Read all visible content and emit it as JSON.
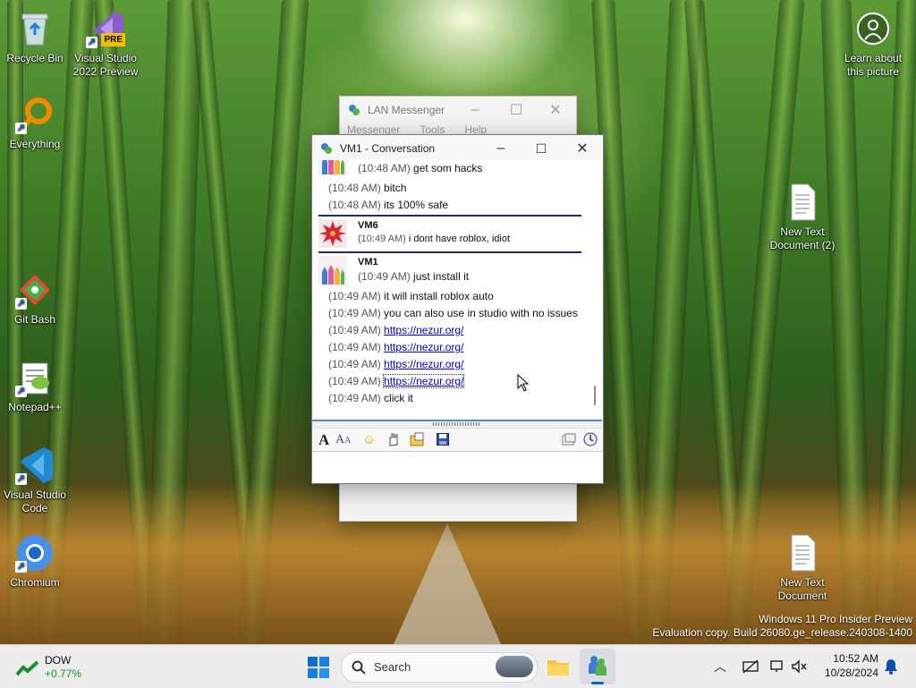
{
  "desktop": {
    "icons_left": [
      {
        "label": "Recycle Bin",
        "icon": "recycle-bin-icon"
      },
      {
        "label": "Visual Studio 2022 Preview",
        "icon": "visual-studio-icon",
        "badge": "PRE"
      },
      {
        "label": "Everything",
        "icon": "search-magnifier-icon"
      },
      {
        "label": "Git Bash",
        "icon": "git-icon"
      },
      {
        "label": "Notepad++",
        "icon": "notepad-plus-icon"
      },
      {
        "label": "Visual Studio Code",
        "icon": "vscode-icon"
      },
      {
        "label": "Chromium",
        "icon": "chromium-icon"
      }
    ],
    "icons_right": [
      {
        "label": "Learn about this picture",
        "icon": "learn-picture-icon"
      },
      {
        "label": "New Text Document (2)",
        "icon": "text-document-icon"
      },
      {
        "label": "New Text Document",
        "icon": "text-document-icon"
      }
    ],
    "watermark": {
      "line1": "Windows 11 Pro Insider Preview",
      "line2": "Evaluation copy. Build 26080.ge_release.240308-1400"
    }
  },
  "lan_window": {
    "title": "LAN Messenger",
    "menu": [
      "Messenger",
      "Tools",
      "Help"
    ]
  },
  "conv_window": {
    "title": "VM1 - Conversation",
    "messages": [
      {
        "time": "(10:48 AM)",
        "text": "get som hacks"
      },
      {
        "time": "(10:48 AM)",
        "text": "bitch"
      },
      {
        "time": "(10:48 AM)",
        "text": "its 100%  safe"
      },
      {
        "sender": "VM6",
        "time": "(10:49 AM)",
        "text": "i dont have roblox, idiot"
      },
      {
        "sender": "VM1",
        "time": "(10:49 AM)",
        "text": "just install it"
      },
      {
        "time": "(10:49 AM)",
        "text": "it will install roblox auto"
      },
      {
        "time": "(10:49 AM)",
        "text": "you can also use in studio with no issues"
      },
      {
        "time": "(10:49 AM)",
        "text": "https://nezur.org/",
        "link": true
      },
      {
        "time": "(10:49 AM)",
        "text": "https://nezur.org/",
        "link": true
      },
      {
        "time": "(10:49 AM)",
        "text": "https://nezur.org/",
        "link": true
      },
      {
        "time": "(10:49 AM)",
        "text": "https://nezur.org/",
        "link": true
      },
      {
        "time": "(10:49 AM)",
        "text": "click it"
      }
    ],
    "toolbar_icons": [
      "font-icon",
      "font-size-icon",
      "smiley-icon",
      "nudge-icon",
      "send-file-icon",
      "save-icon",
      "history-icon",
      "info-icon"
    ],
    "input_value": ""
  },
  "taskbar": {
    "widget": {
      "name": "DOW",
      "change": "+0.77%"
    },
    "search_placeholder": "Search",
    "clock": {
      "time": "10:52 AM",
      "date": "10/28/2024"
    }
  },
  "colors": {
    "accent": "#0067c0",
    "separator": "#1e2a78",
    "link": "#0000cc",
    "positive": "#1a8f2e"
  }
}
